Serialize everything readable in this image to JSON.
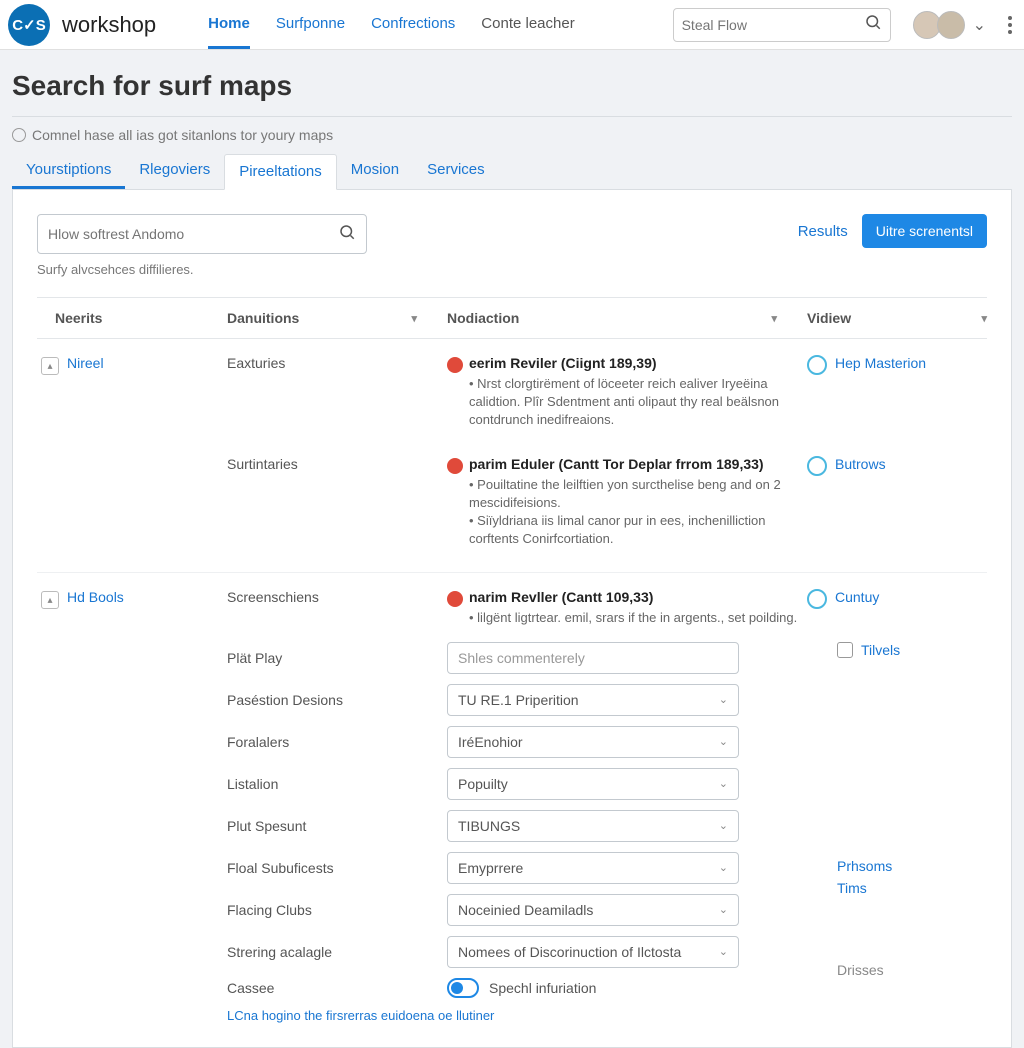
{
  "header": {
    "logo_text": "C✓S",
    "brand": "workshop",
    "nav": [
      "Home",
      "Surfponne",
      "Confrections",
      "Conte leacher"
    ],
    "search_placeholder": "Steal Flow"
  },
  "page": {
    "title": "Search for surf maps",
    "subtitle": "Comnel hase all ias got sitanlons tor youry maps",
    "tabs": [
      "Yourstiptions",
      "Rlegoviers",
      "Pireeltations",
      "Mosion",
      "Services"
    ]
  },
  "filter": {
    "placeholder": "Hlow softrest Andomo",
    "hint": "Surfy alvcsehces diffilieres.",
    "results_label": "Results",
    "button": "Uitre screnentsl"
  },
  "columns": {
    "c1": "Neerits",
    "c2": "Danuitions",
    "c3": "Nodiaction",
    "c4": "Vidiew"
  },
  "rows": {
    "r1": {
      "name": "Nireel",
      "cat": "Eaxturies",
      "title": "eerim Reviler (Ciignt 189,39)",
      "desc": "• Nrst clorgtirëment of löceeter reich ealiver Iryeëina calidtion. Plîr Sdentment anti olipaut thy real beälsnon contdrunch inedifreaions.",
      "action": "Hep Masterion"
    },
    "r2": {
      "cat": "Surtintaries",
      "title": "parim Eduler (Cantt Tor Deplar frrom 189,33)",
      "desc": "• Pouiltatine the leilftien yon surcthelise beng and on 2 mescidifeisions.\n• Siïyldriana iis limal canor pur in ees, inchenilliction corftents Conirfcortiation.",
      "action": "Butrows"
    },
    "r3": {
      "name": "Hd Bools",
      "cats": [
        "Screenschiens",
        "Plät Play",
        "Paséstion Desions",
        "Foralalers",
        "Listalion",
        "Plut Spesunt",
        "Floal Subuficests",
        "Flacing Clubs",
        "Strering acalagle",
        "Cassee"
      ],
      "title": "narim Revller (Cantt 109,33)",
      "desc": "• lilgënt ligtrtear. emil, srars if the in argents., set poilding.",
      "comment_placeholder": "Shles commenterely",
      "selects": [
        "TU RE.1 Priperition",
        "IréEnohior",
        "Popuilty",
        "TIBUNGS",
        "Emyprrere",
        "Noceinied Deamiladls",
        "Nomees of Discorinuction of Ilctosta"
      ],
      "toggle_label": "Spechl infuriation",
      "bottom_link": "LCna hogino the firsrerras euidoena oe llutiner",
      "side": {
        "radio": "Cuntuy",
        "check": "Tilvels",
        "links": [
          "Prhsoms",
          "Tims"
        ],
        "text": "Drisses"
      }
    }
  }
}
